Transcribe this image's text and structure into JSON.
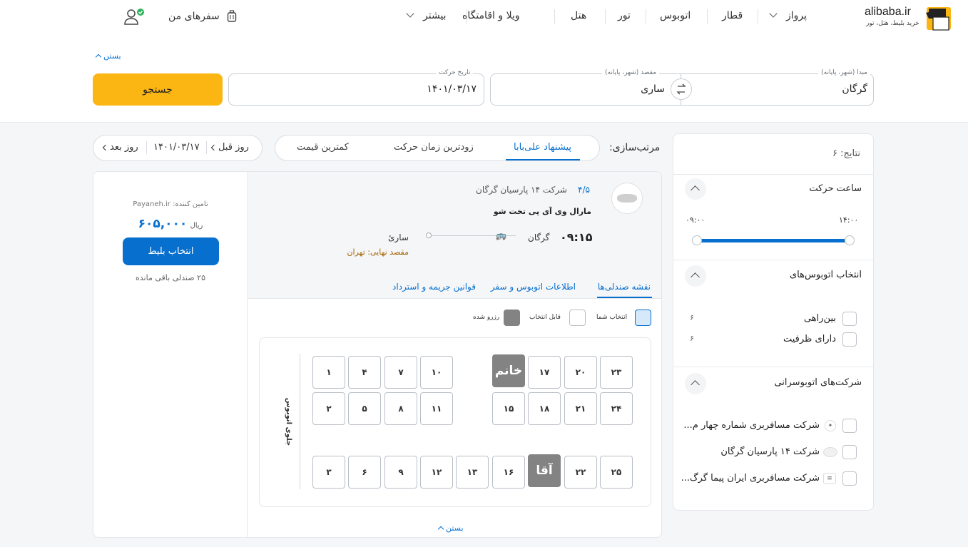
{
  "header": {
    "logo_text": "alibaba.ir",
    "logo_sub": "خرید بلیط، هتل، تور",
    "nav": [
      "پرواز",
      "قطار",
      "اتوبوس",
      "تور",
      "هتل",
      "ویلا و اقامتگاه",
      "بیشتر"
    ],
    "my_trips": "سفرهای من"
  },
  "search": {
    "close_label": "بستن",
    "origin_label": "مبدا (شهر، پایانه)",
    "origin_value": "گرگان",
    "dest_label": "مقصد (شهر، پایانه)",
    "dest_value": "ساری",
    "date_label": "تاریخ حرکت",
    "date_value": "۱۴۰۱/۰۳/۱۷",
    "search_button": "جستجو"
  },
  "sort": {
    "label": "مرتب‌سازی:",
    "options": [
      "پیشنهاد علی‌بابا",
      "زودترین زمان حرکت",
      "کمترین قیمت"
    ],
    "active": "پیشنهاد علی‌بابا"
  },
  "date_nav": {
    "prev": "روز قبل",
    "current": "۱۴۰۱/۰۳/۱۷",
    "next": "روز بعد"
  },
  "filters": {
    "results": "نتایج: ۶",
    "time_title": "ساعت حرکت",
    "time_from": "۰۹:۰۰",
    "time_to": "۱۴:۰۰",
    "bus_title": "انتخاب اتوبوس‌های",
    "bus_options": [
      {
        "label": "بین‌راهی",
        "count": "۶"
      },
      {
        "label": "دارای ظرفیت",
        "count": "۶"
      }
    ],
    "company_title": "شرکت‌های اتوبوسرانی",
    "companies": [
      "شرکت مسافربری شماره چهار م...",
      "شرکت ۱۴ پارسیان گرگان",
      "شرکت مسافربری ایران پیما گرگ..."
    ]
  },
  "ticket": {
    "rating": "۴/۵",
    "company": "شرکت ۱۴ پارسیان گرگان",
    "bus_type": "مارال وی آی پی تخت شو",
    "time": "۰۹:۱۵",
    "origin": "گرگان",
    "destination": "ساریٔ",
    "final_dest": "مقصد نهایی: تهران",
    "provider": "تامین کننده: Payaneh.ir",
    "price": "۶۰۵,۰۰۰",
    "currency": "ریال",
    "select_button": "انتخاب بلیط",
    "remaining": "۲۵ صندلی باقی مانده",
    "tabs": [
      "نقشه صندلی‌ها",
      "اطلاعات اتوبوس و سفر",
      "قوانین جریمه و استرداد"
    ],
    "legend": {
      "selected": "انتخاب شما",
      "available": "قابل انتخاب",
      "reserved": "رزرو شده"
    },
    "bus_front": "جلوی اتوبوس",
    "close_label": "بستن"
  },
  "seats": {
    "row1": [
      "۲۳",
      "۲۰",
      "۱۷",
      "خانم",
      "۱۰",
      "۷",
      "۴",
      "۱"
    ],
    "row2": [
      "۲۴",
      "۲۱",
      "۱۸",
      "۱۵",
      "۱۱",
      "۸",
      "۵",
      "۲"
    ],
    "row3": [
      "۲۵",
      "۲۲",
      "آقا",
      "۱۶",
      "۱۳",
      "۱۲",
      "۹",
      "۶",
      "۳"
    ]
  },
  "colors": {
    "brand_yellow": "#fcb614",
    "primary_blue": "#0770cf",
    "reserved_gray": "#838383"
  }
}
